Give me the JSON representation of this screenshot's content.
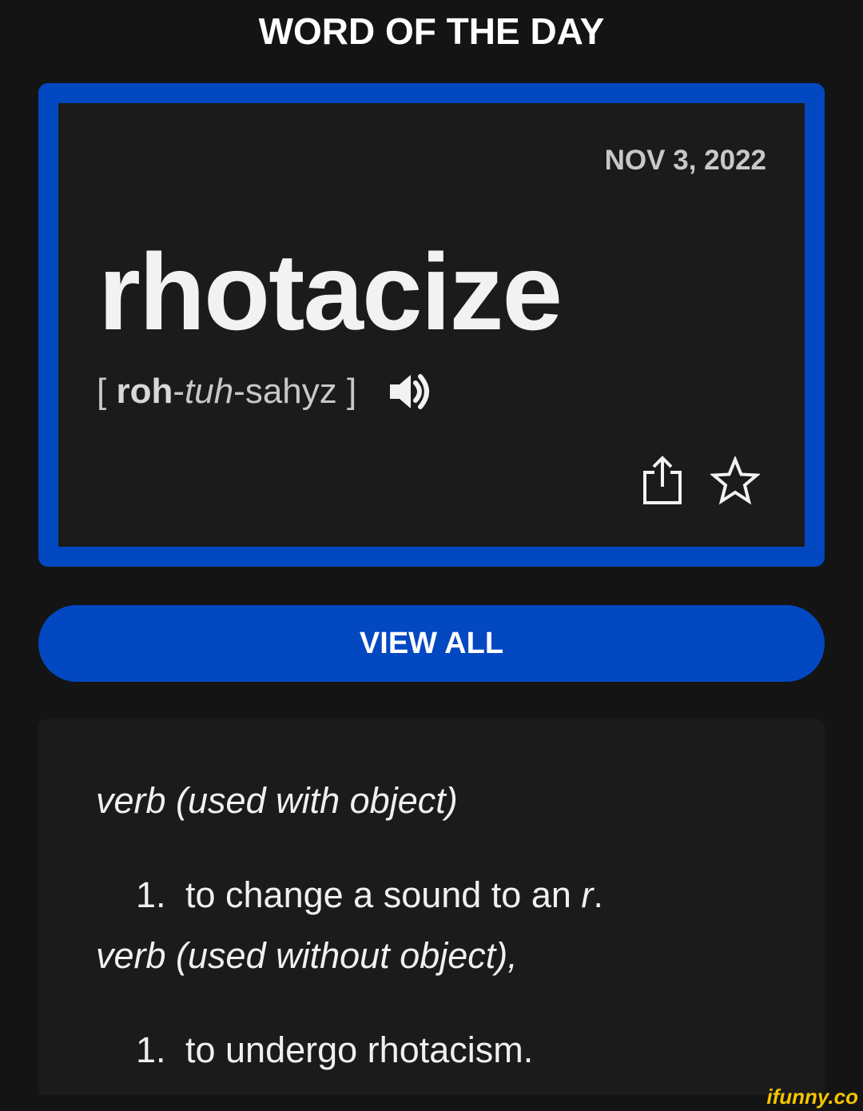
{
  "header": {
    "title": "WORD OF THE DAY"
  },
  "card": {
    "date": "NOV 3, 2022",
    "word": "rhotacize",
    "pronunciation": {
      "open_bracket": "[ ",
      "syllable_stressed": "roh",
      "sep1": "-",
      "syllable_italic": "tuh",
      "rest": "-sahyz",
      "close_bracket": " ]"
    },
    "icons": {
      "audio": "speaker-icon",
      "share": "share-icon",
      "favorite": "star-icon"
    },
    "accent_color": "#0248c1"
  },
  "view_all": {
    "label": "VIEW ALL"
  },
  "definitions": [
    {
      "part_of_speech": "verb (used with object)",
      "items": [
        {
          "num": "1.",
          "text": "to change a sound to an ",
          "italic": "r",
          "end": "."
        }
      ]
    },
    {
      "part_of_speech": "verb (used without object),",
      "items": [
        {
          "num": "1.",
          "text": "to undergo rhotacism."
        }
      ]
    }
  ],
  "watermark": {
    "text": "ifunny.co",
    "color": "#f5c400"
  }
}
